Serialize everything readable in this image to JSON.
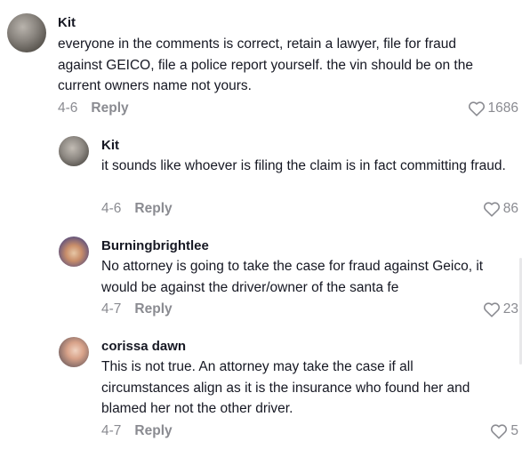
{
  "comments": [
    {
      "author": "Kit",
      "text": "everyone in the comments is correct, retain a lawyer, file for fraud against GEICO, file a police report yourself. the vin should be on the current owners name not yours.",
      "date": "4-6",
      "reply_label": "Reply",
      "likes": "1686"
    },
    {
      "author": "Kit",
      "text": "it sounds like whoever is filing the claim is in fact committing fraud.",
      "date": "4-6",
      "reply_label": "Reply",
      "likes": "86"
    },
    {
      "author": "Burningbrightlee",
      "text": "No attorney is going to take the case for fraud against Geico, it would be against the driver/owner of the santa fe",
      "date": "4-7",
      "reply_label": "Reply",
      "likes": "23"
    },
    {
      "author": "corissa dawn",
      "text": "This is not true. An attorney may take the case if all circumstances align as it is the insurance who found her and blamed her not the other driver.",
      "date": "4-7",
      "reply_label": "Reply",
      "likes": "5"
    }
  ],
  "icons": {
    "like": "heart-outline-icon"
  },
  "colors": {
    "text": "#161823",
    "muted": "#8a8b91"
  }
}
